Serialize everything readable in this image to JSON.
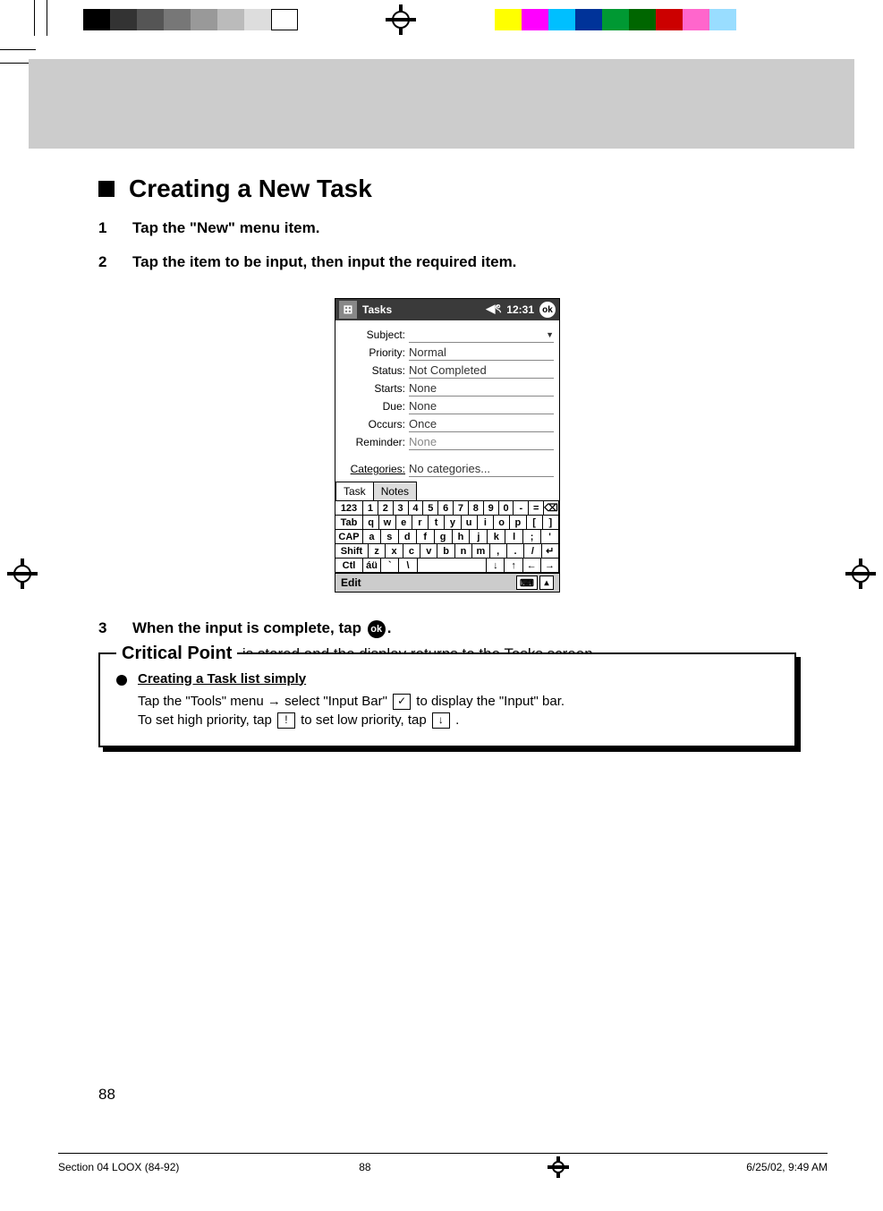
{
  "heading": "Creating a New Task",
  "steps": [
    {
      "num": "1",
      "lead": "Tap the \"New\" menu item."
    },
    {
      "num": "2",
      "lead": "Tap the item to be input, then input the required item."
    },
    {
      "num": "3",
      "lead_before": "When the input is complete, tap ",
      "lead_after": ".",
      "body": "The information is stored and the display returns to the Tasks screen."
    }
  ],
  "pda": {
    "title": "Tasks",
    "time": "12:31",
    "ok": "ok",
    "fields": [
      {
        "label": "Subject:",
        "value": "",
        "dropdown": true
      },
      {
        "label": "Priority:",
        "value": "Normal"
      },
      {
        "label": "Status:",
        "value": "Not Completed"
      },
      {
        "label": "Starts:",
        "value": "None"
      },
      {
        "label": "Due:",
        "value": "None"
      },
      {
        "label": "Occurs:",
        "value": "Once"
      },
      {
        "label": "Reminder:",
        "value": "None",
        "disabled": true
      },
      {
        "label": "Categories:",
        "value": "No categories..."
      }
    ],
    "tabs": [
      "Task",
      "Notes"
    ],
    "keyboard": [
      [
        "123",
        "1",
        "2",
        "3",
        "4",
        "5",
        "6",
        "7",
        "8",
        "9",
        "0",
        "-",
        "=",
        "⌫"
      ],
      [
        "Tab",
        "q",
        "w",
        "e",
        "r",
        "t",
        "y",
        "u",
        "i",
        "o",
        "p",
        "[",
        "]"
      ],
      [
        "CAP",
        "a",
        "s",
        "d",
        "f",
        "g",
        "h",
        "j",
        "k",
        "l",
        ";",
        "'"
      ],
      [
        "Shift",
        "z",
        "x",
        "c",
        "v",
        "b",
        "n",
        "m",
        ",",
        ".",
        "/",
        "↵"
      ],
      [
        "Ctl",
        "áü",
        "`",
        "\\",
        " ",
        "↓",
        "↑",
        "←",
        "→"
      ]
    ],
    "edit": "Edit"
  },
  "critical": {
    "heading": "Critical Point",
    "title": "Creating a Task list simply",
    "line1_a": "Tap the \"Tools\" menu → select \"Input Bar\" ",
    "line1_b": " to display the \"Input\" bar.",
    "line2_a": "To set high priority, tap ",
    "line2_b": " to set low priority, tap ",
    "line2_c": " ."
  },
  "page_number": "88",
  "footer": {
    "left": "Section 04 LOOX (84-92)",
    "center": "88",
    "right": "6/25/02, 9:49 AM"
  },
  "color_bar": [
    "#000",
    "#555",
    "#777",
    "#999",
    "#bbb",
    "#ddd",
    "#fff",
    "",
    "#ffff00",
    "#ff00ff",
    "#00bfff",
    "#003399",
    "#009933",
    "#006600",
    "#cc0000",
    "#ff66cc",
    "#99ddff"
  ],
  "icons": {
    "ok": "ok",
    "check": "✓",
    "excl": "!",
    "down": "↓"
  }
}
